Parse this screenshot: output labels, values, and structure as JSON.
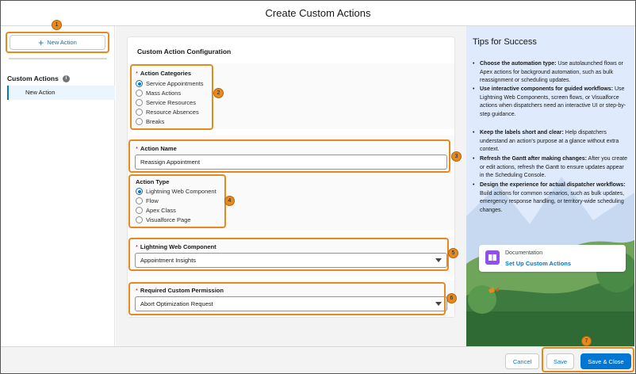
{
  "header": {
    "title": "Create Custom Actions"
  },
  "left": {
    "new_action_label": "New Action",
    "custom_actions_title": "Custom Actions",
    "items": [
      "New Action"
    ]
  },
  "config": {
    "title": "Custom Action Configuration",
    "categories": {
      "label": "Action Categories",
      "options": [
        "Service Appointments",
        "Mass Actions",
        "Service Resources",
        "Resource Absences",
        "Breaks"
      ],
      "selected": "Service Appointments"
    },
    "action_name": {
      "label": "Action Name",
      "value": "Reassign Appointment"
    },
    "action_type": {
      "label": "Action Type",
      "options": [
        "Lightning Web Component",
        "Flow",
        "Apex Class",
        "Visualforce Page"
      ],
      "selected": "Lightning Web Component"
    },
    "lwc": {
      "label": "Lightning Web Component",
      "value": "Appointment Insights"
    },
    "permission": {
      "label": "Required Custom Permission",
      "value": "Abort Optimization Request"
    }
  },
  "tips": {
    "title": "Tips for Success",
    "items": [
      {
        "bold": "Choose the automation type:",
        "text": " Use autolaunched flows or Apex actions for background automation, such as bulk reassignment or scheduling updates."
      },
      {
        "bold": "Use interactive components for guided workflows:",
        "text": " Use Lightning Web Components, screen flows, or Visualforce actions when dispatchers need an interactive UI or step-by-step guidance."
      },
      {
        "bold": "Keep the labels short and clear:",
        "text": " Help dispatchers understand an action's purpose at a glance without extra context."
      },
      {
        "bold": "Refresh the Gantt after making changes:",
        "text": " After you create or edit actions, refresh the Gantt to ensure updates appear in the Scheduling Console."
      },
      {
        "bold": "Design the experience for actual dispatcher workflows:",
        "text": " Build actions for common scenarios, such as bulk updates, emergency response handling, or territory-wide scheduling changes."
      }
    ],
    "doc_label": "Documentation",
    "doc_link": "Set Up Custom Actions"
  },
  "footer": {
    "cancel": "Cancel",
    "save": "Save",
    "save_close": "Save & Close"
  },
  "badges": [
    "1",
    "2",
    "3",
    "4",
    "5",
    "6",
    "7"
  ],
  "colors": {
    "accent": "#0176d3",
    "callout": "#e58a1f",
    "required": "#ba0517",
    "tips_bg": "#dfeafc"
  }
}
